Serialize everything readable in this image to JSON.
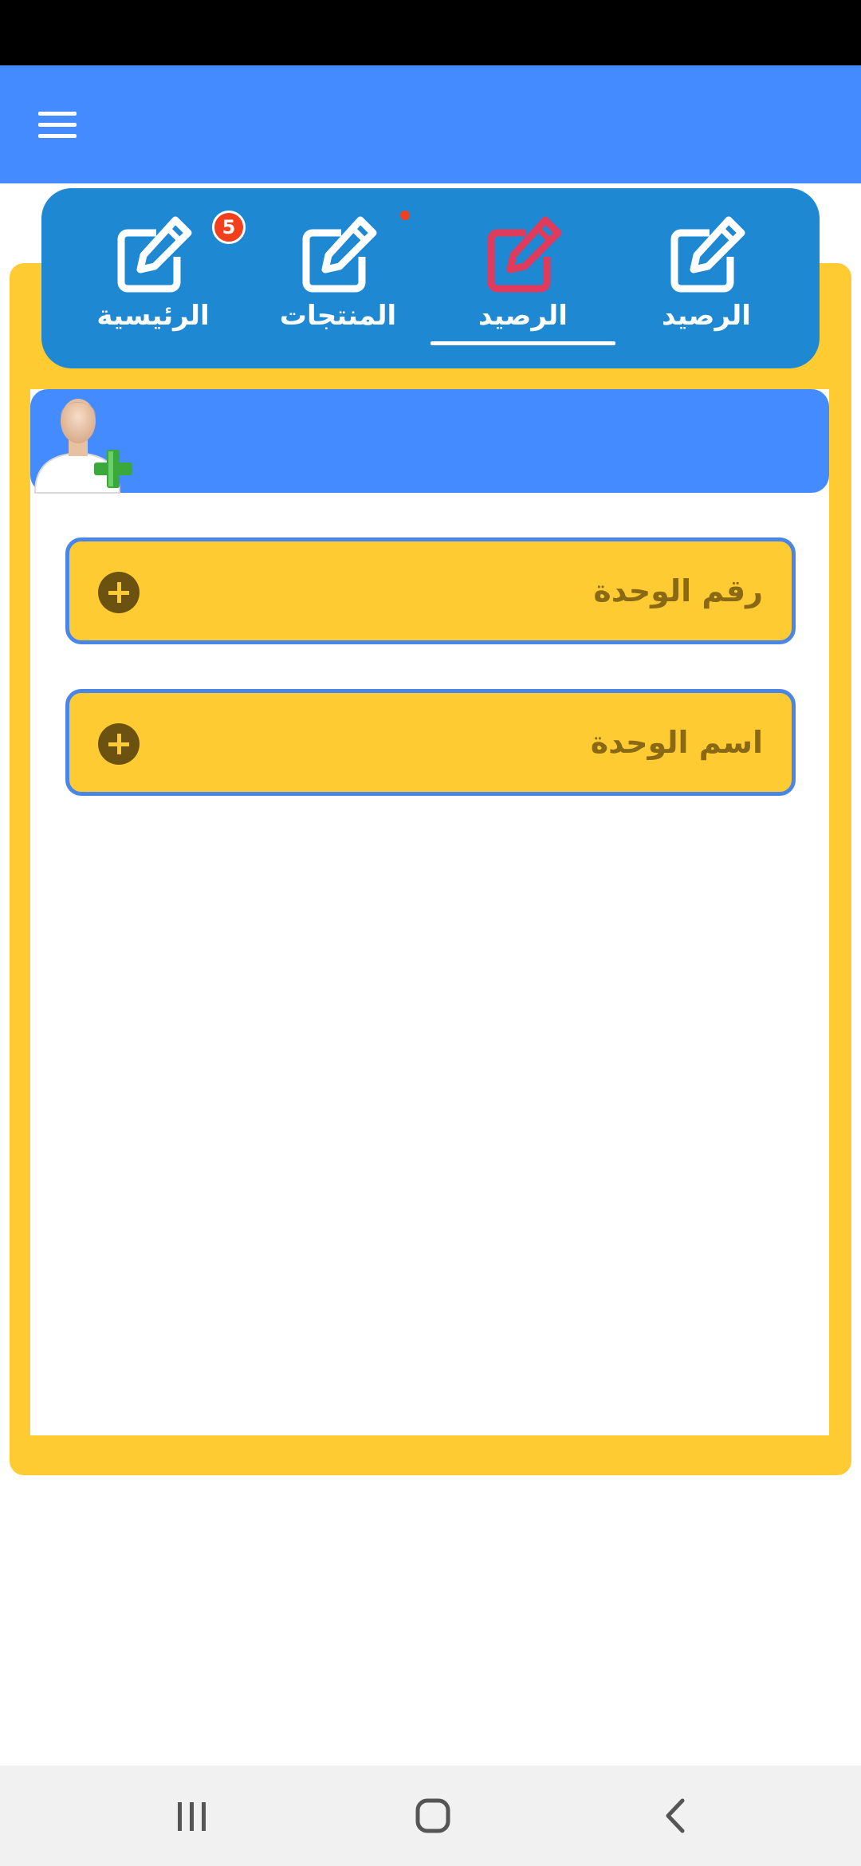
{
  "tabs": [
    {
      "label": "الرصيد",
      "icon": "edit-icon",
      "active": false
    },
    {
      "label": "الرصيد",
      "icon": "edit-icon",
      "active": true
    },
    {
      "label": "المنتجات",
      "icon": "edit-icon",
      "active": false,
      "dot": true
    },
    {
      "label": "الرئيسية",
      "icon": "edit-icon",
      "active": false,
      "badge": "5"
    }
  ],
  "form": {
    "fields": [
      {
        "label": "رقم الوحدة",
        "icon": "plus-circle-icon"
      },
      {
        "label": "اسم الوحدة",
        "icon": "plus-circle-icon"
      }
    ]
  },
  "colors": {
    "app_bar": "#438bff",
    "tab_bar": "#1e88d2",
    "active_tab_icon": "#e03a5c",
    "card": "#ffcb33",
    "field_border": "#4a86e8",
    "badge": "#f2401c"
  },
  "nav": {
    "items": [
      "recents-icon",
      "home-icon",
      "back-icon"
    ]
  }
}
